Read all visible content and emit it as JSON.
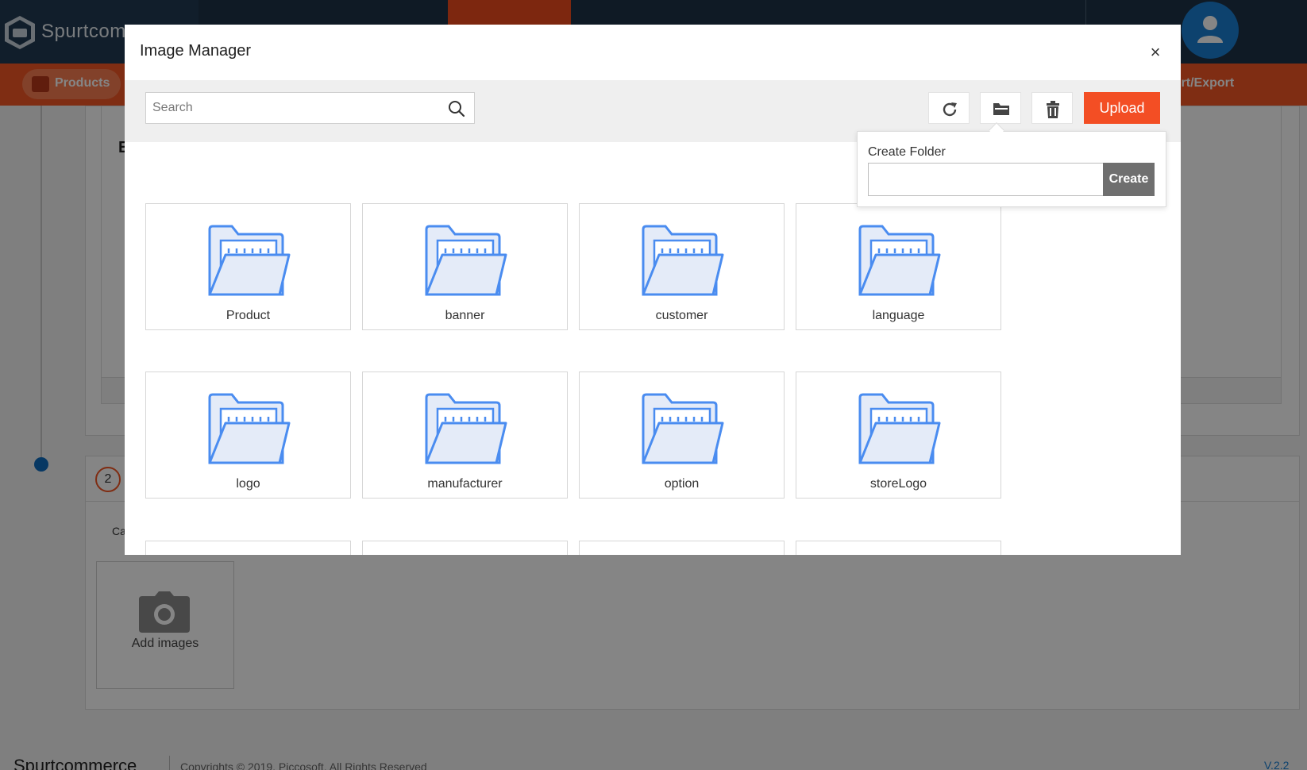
{
  "app": {
    "brand": "Spurtcom",
    "nav_products_label": "Products",
    "nav_export_label": "port/Export"
  },
  "background": {
    "card1_fragment": "E",
    "step_number": "2",
    "card2_label_fragment": "Ca",
    "add_images_label": "Add images",
    "footer_brand": "Spurtcommerce",
    "footer_copyright": "Copyrights © 2019, Piccosoft. All Rights Reserved",
    "version": "V.2.2"
  },
  "modal": {
    "title": "Image Manager",
    "close_glyph": "×",
    "search": {
      "placeholder": "Search",
      "value": ""
    },
    "toolbar": {
      "refresh_icon": "refresh-icon",
      "folder_icon": "folder-open-icon",
      "delete_icon": "trash-icon",
      "upload_label": "Upload"
    },
    "create_folder": {
      "title": "Create Folder",
      "input_value": "",
      "button_label": "Create"
    },
    "folders": [
      {
        "name": "Product"
      },
      {
        "name": "banner"
      },
      {
        "name": "customer"
      },
      {
        "name": "language"
      },
      {
        "name": "logo"
      },
      {
        "name": "manufacturer"
      },
      {
        "name": "option"
      },
      {
        "name": "storeLogo"
      }
    ]
  },
  "colors": {
    "accent": "#f34e24",
    "navy": "#1d3247",
    "folder_blue": "#4a8cf0",
    "folder_fill": "#e4ebf8"
  }
}
